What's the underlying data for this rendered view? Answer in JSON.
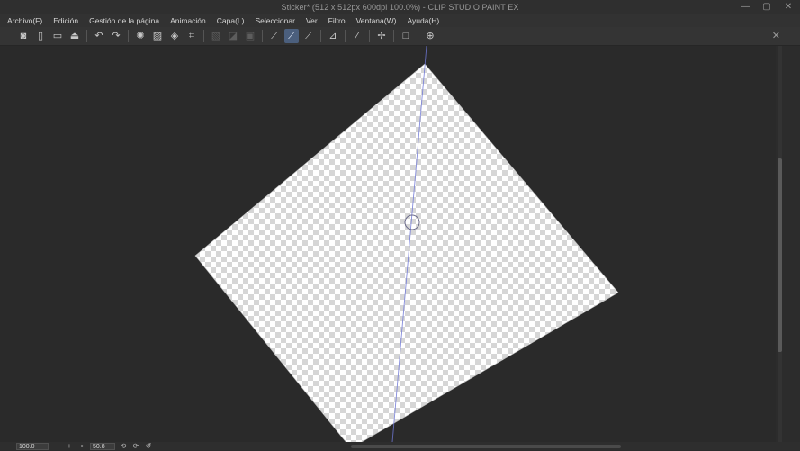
{
  "window": {
    "title": "Sticker* (512 x 512px 600dpi 100.0%) - CLIP STUDIO PAINT EX",
    "controls": [
      "—",
      "▢",
      "✕"
    ]
  },
  "menu": {
    "items": [
      "Archivo(F)",
      "Edición",
      "Gestión de la página",
      "Animación",
      "Capa(L)",
      "Seleccionar",
      "Ver",
      "Filtro",
      "Ventana(W)",
      "Ayuda(H)"
    ]
  },
  "toolbar": {
    "close_glyph": "✕",
    "items": [
      {
        "name": "clip-studio-icon",
        "glyph": "◙"
      },
      {
        "name": "new-file-icon",
        "glyph": "▯"
      },
      {
        "name": "open-file-icon",
        "glyph": "▭"
      },
      {
        "name": "save-icon",
        "glyph": "⏏"
      },
      {
        "name": "sep"
      },
      {
        "name": "undo-icon",
        "glyph": "↶"
      },
      {
        "name": "redo-icon",
        "glyph": "↷"
      },
      {
        "name": "sep"
      },
      {
        "name": "clear-icon",
        "glyph": "✺"
      },
      {
        "name": "clear-outside-icon",
        "glyph": "▨"
      },
      {
        "name": "fill-icon",
        "glyph": "◈"
      },
      {
        "name": "crop-icon",
        "glyph": "⌗"
      },
      {
        "name": "sep"
      },
      {
        "name": "deselect-icon",
        "glyph": "▧",
        "dim": true
      },
      {
        "name": "invert-selection-icon",
        "glyph": "◪",
        "dim": true
      },
      {
        "name": "selection-border-icon",
        "glyph": "▣",
        "dim": true
      },
      {
        "name": "sep"
      },
      {
        "name": "snap-ruler-icon",
        "glyph": "⟋"
      },
      {
        "name": "snap-special-ruler-icon",
        "glyph": "⟋",
        "active": true
      },
      {
        "name": "snap-grid-icon",
        "glyph": "⟋"
      },
      {
        "name": "sep"
      },
      {
        "name": "ruler-icon",
        "glyph": "⊿"
      },
      {
        "name": "sep"
      },
      {
        "name": "straight-line-icon",
        "glyph": "∕"
      },
      {
        "name": "sep"
      },
      {
        "name": "magic-wand-icon",
        "glyph": "✢"
      },
      {
        "name": "sep"
      },
      {
        "name": "rectangle-icon",
        "glyph": "□"
      },
      {
        "name": "sep"
      },
      {
        "name": "zoom-tool-icon",
        "glyph": "⊕"
      }
    ]
  },
  "status": {
    "zoom": "100.0",
    "angle": "50.8"
  }
}
